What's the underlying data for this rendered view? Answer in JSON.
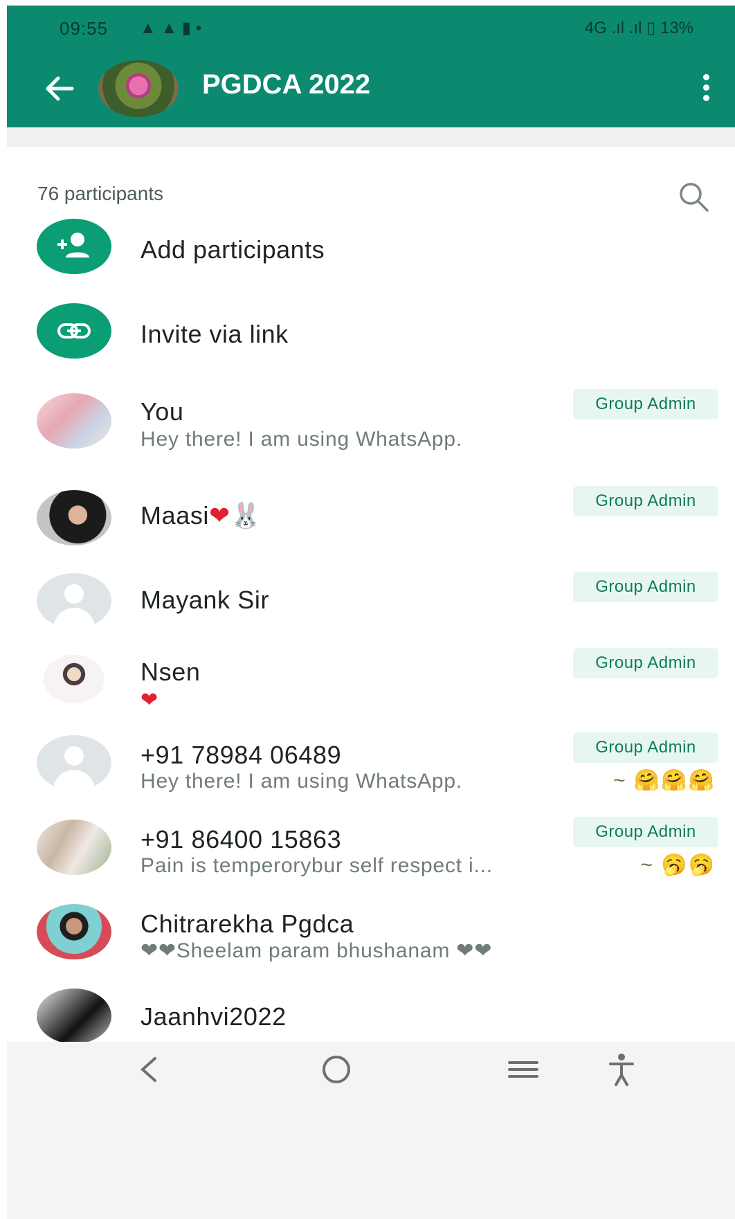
{
  "status_bar": {
    "time": "09:55",
    "left_icons": "▲ ▲ ▮ •",
    "right_text": "4G .ıl .ıl ▯ 13%"
  },
  "header": {
    "title": "PGDCA 2022"
  },
  "participants": {
    "count_text": "76 participants"
  },
  "actions": [
    {
      "label": "Add participants",
      "icon": "add-person-icon"
    },
    {
      "label": "Invite via link",
      "icon": "link-icon"
    }
  ],
  "members": [
    {
      "name": "You",
      "about": "Hey there! I am using WhatsApp.",
      "badge": "Group Admin",
      "suffix": ""
    },
    {
      "name": "Maasi",
      "name_emoji": "❤🐰",
      "about": "",
      "badge": "Group Admin",
      "suffix": ""
    },
    {
      "name": "Mayank Sir",
      "about": "",
      "badge": "Group Admin",
      "suffix": ""
    },
    {
      "name": "Nsen",
      "about": "❤",
      "badge": "Group Admin",
      "suffix": ""
    },
    {
      "name": "+91 78984 06489",
      "about": "Hey there! I am using WhatsApp.",
      "badge": "Group Admin",
      "suffix": "~ 🤗🤗🤗"
    },
    {
      "name": "+91 86400 15863",
      "about": "Pain is temperorybur self respect i...",
      "badge": "Group Admin",
      "suffix": "~ 🥱🥱"
    },
    {
      "name": "Chitrarekha Pgdca",
      "about": "❤❤Sheelam param bhushanam ❤❤",
      "badge": "",
      "suffix": ""
    },
    {
      "name": "Jaanhvi2022",
      "about": "",
      "badge": "",
      "suffix": ""
    }
  ],
  "colors": {
    "brand": "#0b8a70",
    "accent": "#0b9d74",
    "badge_bg": "#e7f7f0"
  }
}
